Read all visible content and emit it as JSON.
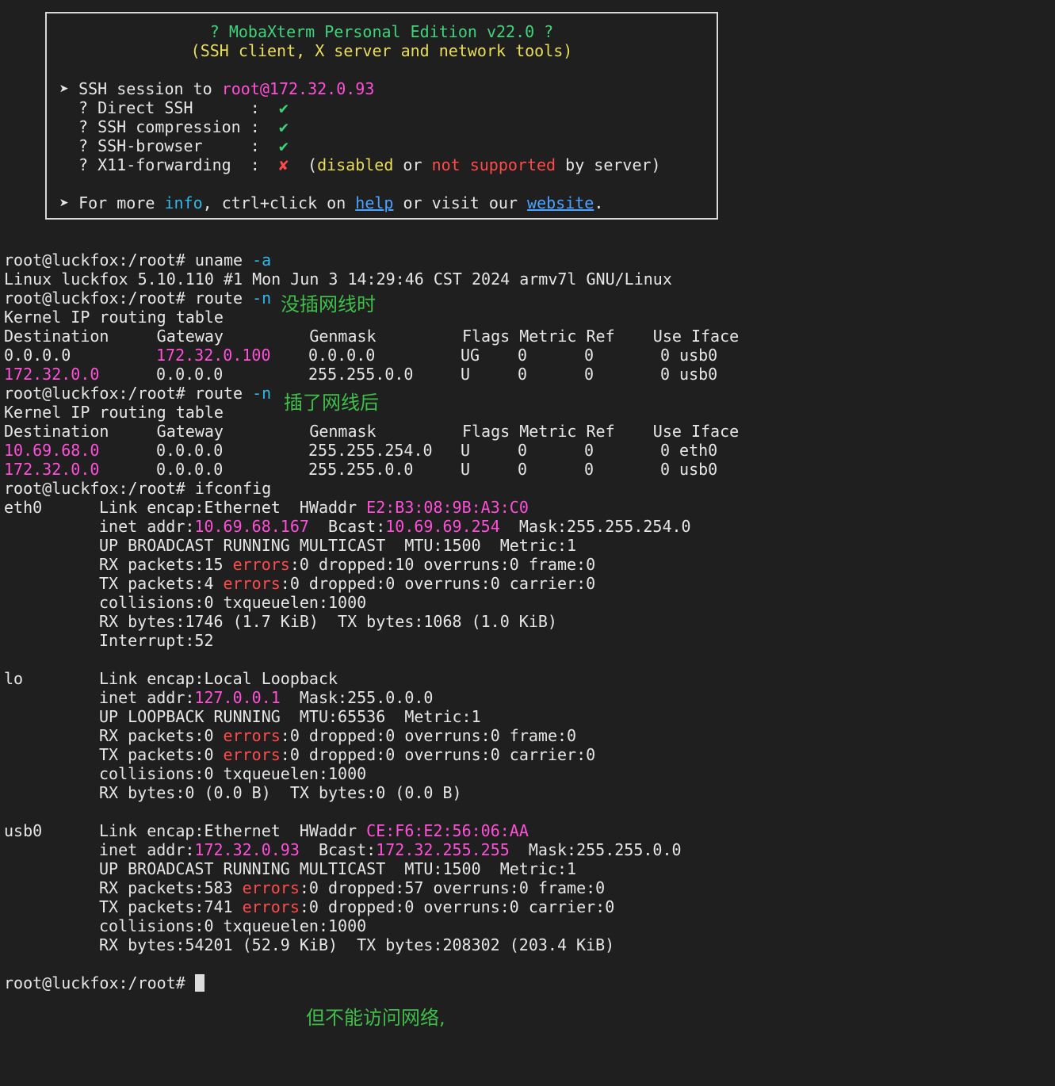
{
  "banner": {
    "title": "? MobaXterm Personal Edition v22.0 ?",
    "subtitle": "(SSH client, X server and network tools)",
    "session_prefix": "➤ SSH session to ",
    "session_target": "root@172.32.0.93",
    "features": [
      {
        "label": "? Direct SSH      :",
        "mark": "✔"
      },
      {
        "label": "? SSH compression :",
        "mark": "✔"
      },
      {
        "label": "? SSH-browser     :",
        "mark": "✔"
      },
      {
        "label": "? X11-forwarding  :",
        "mark": "✘"
      }
    ],
    "x11_note": {
      "open": "(",
      "w1": "disabled",
      "w2": " or ",
      "w3": "not supported",
      "w4": " by server)"
    },
    "footer": {
      "p1": "➤ For more ",
      "info": "info",
      "p2": ", ctrl+click on ",
      "help": "help",
      "p3": " or visit our ",
      "website": "website",
      "p4": "."
    }
  },
  "prompt": "root@luckfox:/root# ",
  "lines": {
    "cmd1": "uname",
    "cmd1_arg": "-a",
    "uname_out": "Linux luckfox 5.10.110 #1 Mon Jun 3 14:29:46 CST 2024 armv7l GNU/Linux",
    "cmd2": "route",
    "cmd2_arg": "-n",
    "kernel_table": "Kernel IP routing table",
    "route_header": "Destination     Gateway         Genmask         Flags Metric Ref    Use Iface",
    "cmd4": "ifconfig"
  },
  "route1": [
    {
      "dest": "0.0.0.0",
      "gw": "172.32.0.100",
      "mask": "0.0.0.0",
      "flags": "UG",
      "metric": "0",
      "ref": "0",
      "use": "0",
      "iface": "usb0"
    },
    {
      "dest": "172.32.0.0",
      "gw": "0.0.0.0",
      "mask": "255.255.0.0",
      "flags": "U",
      "metric": "0",
      "ref": "0",
      "use": "0",
      "iface": "usb0"
    }
  ],
  "route2": [
    {
      "dest": "10.69.68.0",
      "gw": "0.0.0.0",
      "mask": "255.255.254.0",
      "flags": "U",
      "metric": "0",
      "ref": "0",
      "use": "0",
      "iface": "eth0"
    },
    {
      "dest": "172.32.0.0",
      "gw": "0.0.0.0",
      "mask": "255.255.0.0",
      "flags": "U",
      "metric": "0",
      "ref": "0",
      "use": "0",
      "iface": "usb0"
    }
  ],
  "ifaces": {
    "eth0": {
      "name": "eth0",
      "l1a": "Link encap:Ethernet  HWaddr ",
      "hw": "E2:B3:08:9B:A3:C0",
      "l2a": "inet addr:",
      "addr": "10.69.68.167",
      "l2b": "  Bcast:",
      "bcast": "10.69.69.254",
      "l2c": "  Mask:255.255.254.0",
      "l3": "UP BROADCAST RUNNING MULTICAST  MTU:1500  Metric:1",
      "l4a": "RX packets:15 ",
      "l4b": ":0 dropped:10 overruns:0 frame:0",
      "l5a": "TX packets:4 ",
      "l5b": ":0 dropped:0 overruns:0 carrier:0",
      "l6": "collisions:0 txqueuelen:1000",
      "l7": "RX bytes:1746 (1.7 KiB)  TX bytes:1068 (1.0 KiB)",
      "l8": "Interrupt:52"
    },
    "lo": {
      "name": "lo",
      "l1": "Link encap:Local Loopback",
      "l2a": "inet addr:",
      "addr": "127.0.0.1",
      "l2c": "  Mask:255.0.0.0",
      "l3": "UP LOOPBACK RUNNING  MTU:65536  Metric:1",
      "l4a": "RX packets:0 ",
      "l4b": ":0 dropped:0 overruns:0 frame:0",
      "l5a": "TX packets:0 ",
      "l5b": ":0 dropped:0 overruns:0 carrier:0",
      "l6": "collisions:0 txqueuelen:1000",
      "l7": "RX bytes:0 (0.0 B)  TX bytes:0 (0.0 B)"
    },
    "usb0": {
      "name": "usb0",
      "l1a": "Link encap:Ethernet  HWaddr ",
      "hw": "CE:F6:E2:56:06:AA",
      "l2a": "inet addr:",
      "addr": "172.32.0.93",
      "l2b": "  Bcast:",
      "bcast": "172.32.255.255",
      "l2c": "  Mask:255.255.0.0",
      "l3": "UP BROADCAST RUNNING MULTICAST  MTU:1500  Metric:1",
      "l4a": "RX packets:583 ",
      "l4b": ":0 dropped:57 overruns:0 frame:0",
      "l5a": "TX packets:741 ",
      "l5b": ":0 dropped:0 overruns:0 carrier:0",
      "l6": "collisions:0 txqueuelen:1000",
      "l7": "RX bytes:54201 (52.9 KiB)  TX bytes:208302 (203.4 KiB)"
    }
  },
  "errors_word": "errors",
  "annotations": {
    "before": "没插网线时",
    "after": "插了网线后",
    "bottom": "但不能访问网络,"
  },
  "colors": {
    "background": "#1f1f1f",
    "magenta": "#ff4fd8",
    "green": "#3fd47a",
    "annotation": "#3fbf4a"
  }
}
